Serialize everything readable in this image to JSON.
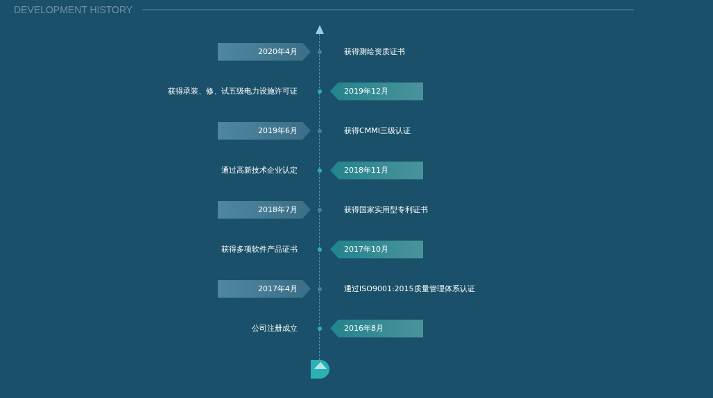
{
  "header": {
    "title": "DEVELOPMENT HISTORY"
  },
  "timeline": [
    {
      "kind": "left",
      "date": "2020年4月",
      "text": "获得测绘资质证书"
    },
    {
      "kind": "right",
      "date": "2019年12月",
      "text": "获得承装、修、试五级电力设施许可证"
    },
    {
      "kind": "left",
      "date": "2019年6月",
      "text": "获得CMMI三级认证"
    },
    {
      "kind": "right",
      "date": "2018年11月",
      "text": "通过高新技术企业认定"
    },
    {
      "kind": "left",
      "date": "2018年7月",
      "text": "获得国家实用型专利证书"
    },
    {
      "kind": "right",
      "date": "2017年10月",
      "text": "获得多项软件产品证书"
    },
    {
      "kind": "left",
      "date": "2017年4月",
      "text": "通过ISO9001:2015质量管理体系认证"
    },
    {
      "kind": "right",
      "date": "2016年8月",
      "text": "公司注册成立"
    }
  ]
}
